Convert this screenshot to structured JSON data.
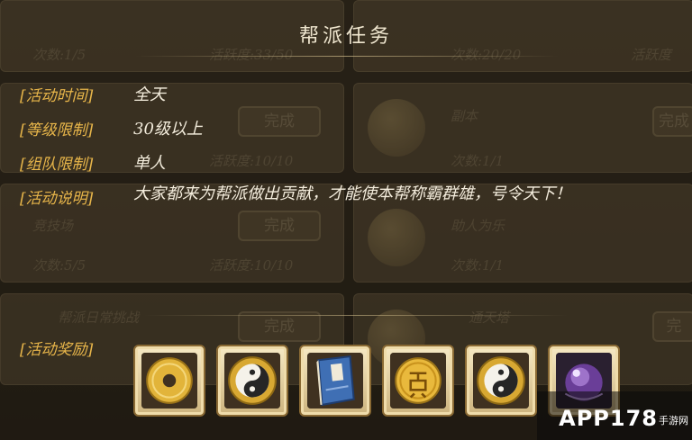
{
  "dialog": {
    "title": "帮派任务",
    "rows": [
      {
        "label": "[活动时间]",
        "value": "全天"
      },
      {
        "label": "[等级限制]",
        "value": "30级以上"
      },
      {
        "label": "[组队限制]",
        "value": "单人"
      },
      {
        "label": "[活动说明]",
        "value": "大家都来为帮派做出贡献，才能使本帮称霸群雄，号令天下！"
      }
    ],
    "reward_label": "[活动奖励]",
    "rewards": [
      {
        "icon": "copper-coin-icon"
      },
      {
        "icon": "yin-yang-icon"
      },
      {
        "icon": "skill-book-icon"
      },
      {
        "icon": "contribution-coin-icon"
      },
      {
        "icon": "yin-yang-icon"
      },
      {
        "icon": "purple-gem-icon"
      }
    ]
  },
  "background_panel": {
    "texts": [
      "次数:1/5",
      "活跃度:33/50",
      "次数:20/20",
      "活跃度",
      "副本",
      "次数:1/1",
      "活跃度:10/10",
      "竞技场",
      "助人为乐",
      "次数:5/5",
      "活跃度:10/10",
      "次数:1/1",
      "帮派日常挑战",
      "通天塔"
    ],
    "buttons": [
      "完成",
      "完成",
      "完成",
      "完成",
      "完"
    ]
  },
  "watermark": {
    "logo": "APP178",
    "sub": "手游网"
  },
  "colors": {
    "label": "#e8b64a",
    "value": "#f3ecdc",
    "title": "#efe6cf"
  }
}
